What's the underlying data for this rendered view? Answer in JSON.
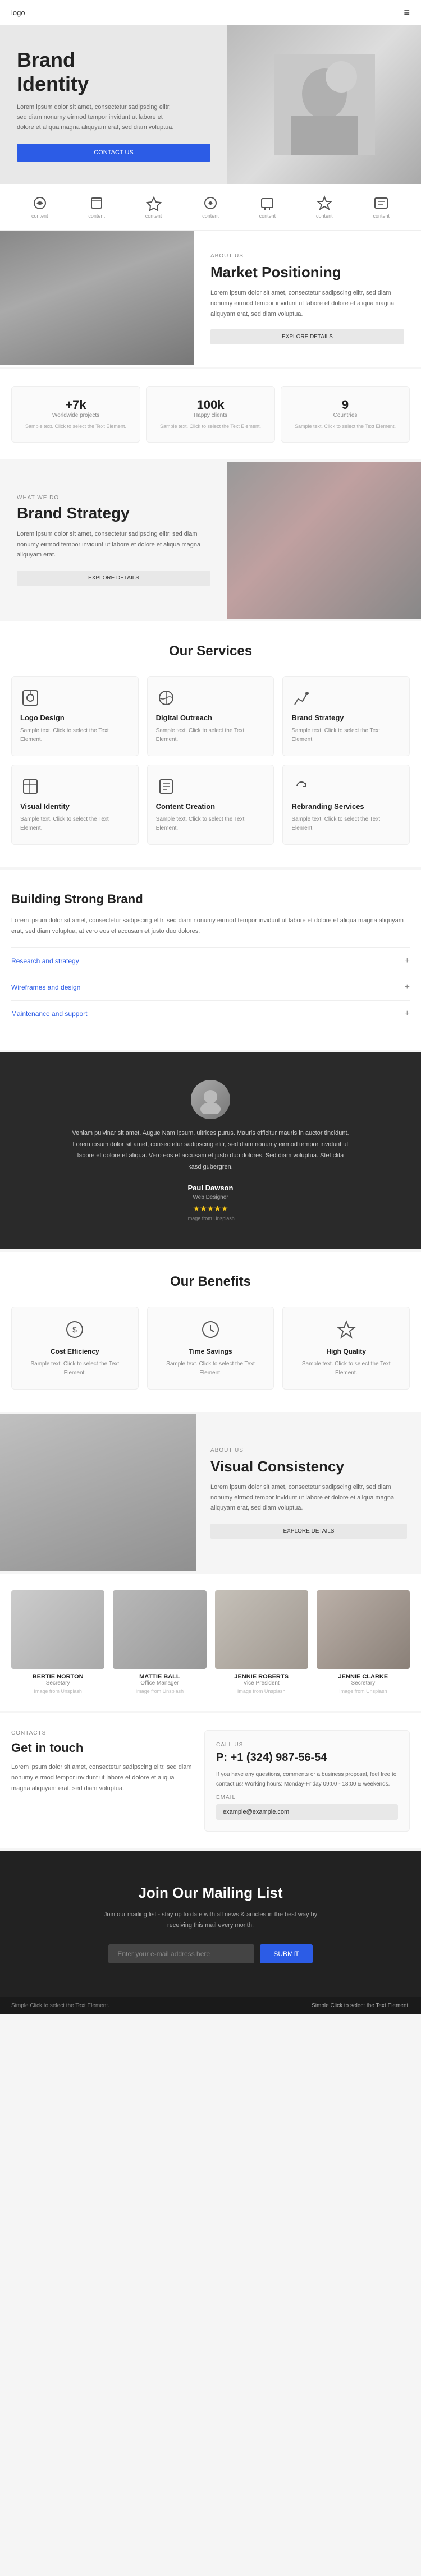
{
  "header": {
    "logo": "logo",
    "menu_icon": "≡"
  },
  "hero": {
    "title": "Brand\nIdentity",
    "text": "Lorem ipsum dolor sit amet, consectetur sadipscing elitr, sed diam nonumy eirmod tempor invidunt ut labore et dolore et aliqua magna aliquyam erat, sed diam voluptua.",
    "cta_label": "CONTACT US"
  },
  "icons_bar": {
    "items": [
      {
        "id": "icon1",
        "label": "content"
      },
      {
        "id": "icon2",
        "label": "content"
      },
      {
        "id": "icon3",
        "label": "content"
      },
      {
        "id": "icon4",
        "label": "content"
      },
      {
        "id": "icon5",
        "label": "content"
      },
      {
        "id": "icon6",
        "label": "content"
      },
      {
        "id": "icon7",
        "label": "content"
      }
    ]
  },
  "market_section": {
    "label": "ABOUT US",
    "title": "Market Positioning",
    "text": "Lorem ipsum dolor sit amet, consectetur sadipscing elitr, sed diam nonumy eirmod tempor invidunt ut labore et dolore et aliqua magna aliquyam erat, sed diam voluptua.",
    "cta_label": "EXPLORE DETAILS"
  },
  "stats": {
    "items": [
      {
        "value": "+7k",
        "label": "Worldwide projects",
        "text": "Sample text. Click to select the Text Element."
      },
      {
        "value": "100k",
        "label": "Happy clients",
        "text": "Sample text. Click to select the Text Element."
      },
      {
        "value": "9",
        "label": "Countries",
        "text": "Sample text. Click to select the Text Element."
      }
    ]
  },
  "brand_strategy": {
    "what_label": "WHAT WE DO",
    "title": "Brand Strategy",
    "text": "Lorem ipsum dolor sit amet, consectetur sadipscing elitr, sed diam nonumy eirmod tempor invidunt ut labore et dolore et aliqua magna aliquyam erat.",
    "cta_label": "EXPLORE DETAILS"
  },
  "services": {
    "heading": "Our Services",
    "items": [
      {
        "name": "Logo Design",
        "text": "Sample text. Click to select the Text Element."
      },
      {
        "name": "Digital Outreach",
        "text": "Sample text. Click to select the Text Element."
      },
      {
        "name": "Brand Strategy",
        "text": "Sample text. Click to select the Text Element."
      },
      {
        "name": "Visual Identity",
        "text": "Sample text. Click to select the Text Element."
      },
      {
        "name": "Content Creation",
        "text": "Sample text. Click to select the Text Element."
      },
      {
        "name": "Rebranding Services",
        "text": "Sample text. Click to select the Text Element."
      }
    ]
  },
  "building": {
    "title": "Building Strong Brand",
    "text": "Lorem ipsum dolor sit amet, consectetur sadipscing elitr, sed diam nonumy eirmod tempor invidunt ut labore et dolore et aliqua magna aliquyam erat, sed diam voluptua, at vero eos et accusam et justo duo dolores.",
    "accordion": [
      {
        "label": "Research and strategy",
        "open": true
      },
      {
        "label": "Wireframes and design",
        "open": false
      },
      {
        "label": "Maintenance and support",
        "open": false
      }
    ]
  },
  "testimonial": {
    "text": "Veniam pulvinar sit amet. Augue Nam ipsum, ultrices purus. Mauris efficitur mauris in auctor tincidunt. Lorem ipsum dolor sit amet, consectetur sadipscing elitr, sed diam nonumy eirmod tempor invidunt ut labore et dolore et aliqua. Vero eos et accusam et justo duo dolores. Sed diam voluptua. Stet clita kasd gubergren.",
    "name": "Paul Dawson",
    "role": "Web Designer",
    "stars": "★★★★★",
    "caption": "Image from Unsplash"
  },
  "benefits": {
    "heading": "Our Benefits",
    "items": [
      {
        "name": "Cost Efficiency",
        "text": "Sample text. Click to select the Text Element."
      },
      {
        "name": "Time Savings",
        "text": "Sample text. Click to select the Text Element."
      },
      {
        "name": "High Quality",
        "text": "Sample text. Click to select the Text Element."
      }
    ]
  },
  "visual_consistency": {
    "label": "ABOUT US",
    "title": "Visual Consistency",
    "text": "Lorem ipsum dolor sit amet, consectetur sadipscing elitr, sed diam nonumy eirmod tempor invidunt ut labore et dolore et aliqua magna aliquyam erat, sed diam voluptua.",
    "cta_label": "EXPLORE DETAILS"
  },
  "team": {
    "members": [
      {
        "name": "BERTIE NORTON",
        "role": "Secretary",
        "caption": "Image from Unsplash"
      },
      {
        "name": "MATTIE BALL",
        "role": "Office Manager",
        "caption": "Image from Unsplash"
      },
      {
        "name": "JENNIE ROBERTS",
        "role": "Vice President",
        "caption": "Image from Unsplash"
      },
      {
        "name": "JENNIE CLARKE",
        "role": "Secretary",
        "caption": "Image from Unsplash"
      }
    ]
  },
  "contact": {
    "label": "CONTACTS",
    "title": "Get in touch",
    "text": "Lorem ipsum dolor sit amet, consectetur sadipscing elitr, sed diam nonumy eirmod tempor invidunt ut labore et dolore et aliqua magna aliquyam erat, sed diam voluptua.",
    "call_label": "CALL US",
    "phone": "P: +1 (324) 987-56-54",
    "info": "If you have any questions, comments or a business proposal, feel free to contact us! Working hours: Monday-Friday 09:00 - 18:00 & weekends.",
    "email_label": "EMAIL",
    "email": "example@example.com"
  },
  "mailing": {
    "title": "Join Our Mailing List",
    "text": "Join our mailing list - stay up to date with all news & articles in the best way by receiving this mail every month.",
    "input_placeholder": "Enter your e-mail address here",
    "submit_label": "SUBMIT"
  },
  "footer": {
    "left_text": "Simple Click to select the Text Element.",
    "link_text": "Simple Click to select the Text Element."
  },
  "colors": {
    "accent": "#2c5ce6",
    "dark_bg": "#222222",
    "card_bg": "#fafafa",
    "border": "#eeeeee"
  }
}
